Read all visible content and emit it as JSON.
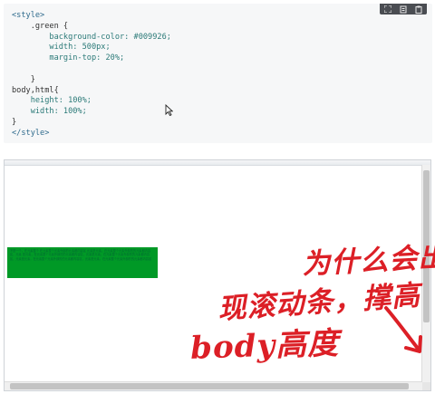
{
  "code": {
    "lines": [
      "<style>",
      "    .green {",
      "        background-color: #009926;",
      "        width: 500px;",
      "        margin-top: 20%;",
      "",
      "    }",
      "body,html{",
      "    height: 100%;",
      "    width: 100%;",
      "}",
      "</style>"
    ],
    "toolbar_icons": [
      "expand-icon",
      "copy-icon",
      "clipboard-icon"
    ]
  },
  "preview": {
    "green_box_text": "不是一个，在元素整个 在元素整个元素外部的元素都内容区 元素是元素，在元素整个元素外部的的元素都内容区，元素 是元素，在元素整个元素外部的的元素都内容区，元素是元素，在元素整个元素外部的的元素都内容区，元素是元素，在元素整个元素外部的的元素都内容区，元素是元素，在元素整个元素外部的的元素都内容区"
  },
  "annotations": {
    "line1": "为什么会出",
    "line2": "现滚动条，撑高",
    "line3": "body高度"
  },
  "colors": {
    "green": "#009926",
    "ink": "#dc1f26"
  }
}
